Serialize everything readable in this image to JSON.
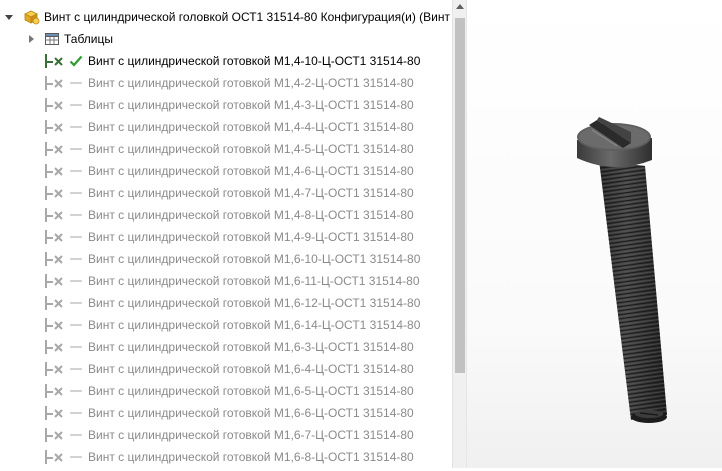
{
  "tree": {
    "root_label": "Винт с цилиндрической головкой ОСТ1 31514-80 Конфигурация(и)  (Винт",
    "tables_label": "Таблицы",
    "active_config": "Винт с цилиндрической готовкой М1,4-10-Ц-ОСТ1 31514-80",
    "configs": [
      "Винт с цилиндрической готовкой М1,4-2-Ц-ОСТ1 31514-80",
      "Винт с цилиндрической готовкой М1,4-3-Ц-ОСТ1 31514-80",
      "Винт с цилиндрической готовкой М1,4-4-Ц-ОСТ1 31514-80",
      "Винт с цилиндрической готовкой М1,4-5-Ц-ОСТ1 31514-80",
      "Винт с цилиндрической готовкой М1,4-6-Ц-ОСТ1 31514-80",
      "Винт с цилиндрической готовкой М1,4-7-Ц-ОСТ1 31514-80",
      "Винт с цилиндрической готовкой М1,4-8-Ц-ОСТ1 31514-80",
      "Винт с цилиндрической готовкой М1,4-9-Ц-ОСТ1 31514-80",
      "Винт с цилиндрической готовкой М1,6-10-Ц-ОСТ1 31514-80",
      "Винт с цилиндрической готовкой М1,6-11-Ц-ОСТ1 31514-80",
      "Винт с цилиндрической готовкой М1,6-12-Ц-ОСТ1 31514-80",
      "Винт с цилиндрической готовкой М1,6-14-Ц-ОСТ1 31514-80",
      "Винт с цилиндрической готовкой М1,6-3-Ц-ОСТ1 31514-80",
      "Винт с цилиндрической готовкой М1,6-4-Ц-ОСТ1 31514-80",
      "Винт с цилиндрической готовкой М1,6-5-Ц-ОСТ1 31514-80",
      "Винт с цилиндрической готовкой М1,6-6-Ц-ОСТ1 31514-80",
      "Винт с цилиндрической готовкой М1,6-7-Ц-ОСТ1 31514-80",
      "Винт с цилиндрической готовкой М1,6-8-Ц-ОСТ1 31514-80"
    ]
  },
  "icons": {
    "root": "part-configurations-icon",
    "tables": "table-icon",
    "config": "configuration-icon",
    "active_state": "checkmark-icon",
    "inactive_state": "dash-icon"
  },
  "colors": {
    "active_check": "#2e9b2e",
    "inactive_text": "#8a8a8a",
    "config_icon_active": "#3a6f3a",
    "config_icon_inactive": "#a8a8a8"
  }
}
